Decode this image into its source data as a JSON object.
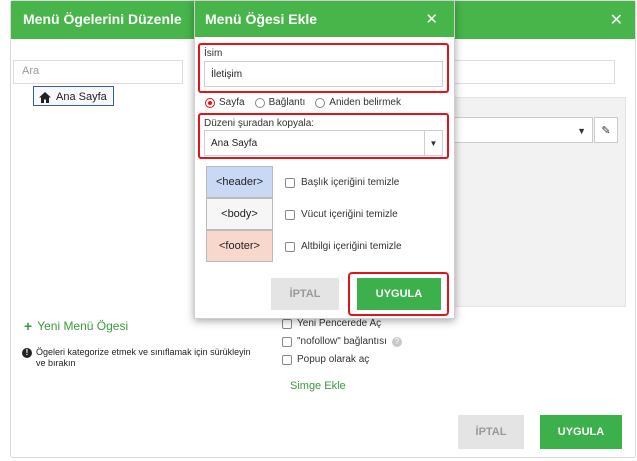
{
  "background": {
    "title": "Menü Ögelerini Düzenle",
    "close_glyph": "✕",
    "search_placeholder": "Ara",
    "tree_item": "Ana Sayfa",
    "new_menu_item": "Yeni Menü Ögesi",
    "info_text": "Ögeleri kategorize etmek ve sınıflamak için sürükleyin ve bırakın",
    "options": {
      "new_window": "Yeni Pencerede Aç",
      "nofollow": "\"nofollow\" bağlantısı",
      "popup": "Popup olarak aç"
    },
    "add_icon_link": "Simge Ekle",
    "cancel_button": "İPTAL",
    "apply_button": "UYGULA"
  },
  "modal": {
    "title": "Menü Öğesi Ekle",
    "close_glyph": "✕",
    "name_label": "İsim",
    "name_value": "İletişim",
    "radios": {
      "page": "Sayfa",
      "link": "Bağlantı",
      "instant": "Aniden belirmek",
      "selected": "Sayfa"
    },
    "copy_label": "Düzeni şuradan kopyala:",
    "copy_value": "Ana Sayfa",
    "sections": {
      "header_tag": "<header>",
      "body_tag": "<body>",
      "footer_tag": "<footer>",
      "clear_header": "Başlık içeriğini temizle",
      "clear_body": "Vücut içeriğini temizle",
      "clear_footer": "Altbilgi içeriğini temizle"
    },
    "cancel_button": "İPTAL",
    "apply_button": "UYGULA"
  },
  "colors": {
    "accent_green": "#47b54a",
    "highlight_red": "#e0141c",
    "header_block": "#c9d8f5",
    "footer_block": "#f8d8cc"
  },
  "icons": {
    "home": "home-icon",
    "plus": "plus-icon",
    "info": "info-icon",
    "pencil": "pencil-icon",
    "help": "help-icon",
    "close": "close-icon",
    "dropdown": "chevron-down-icon"
  }
}
